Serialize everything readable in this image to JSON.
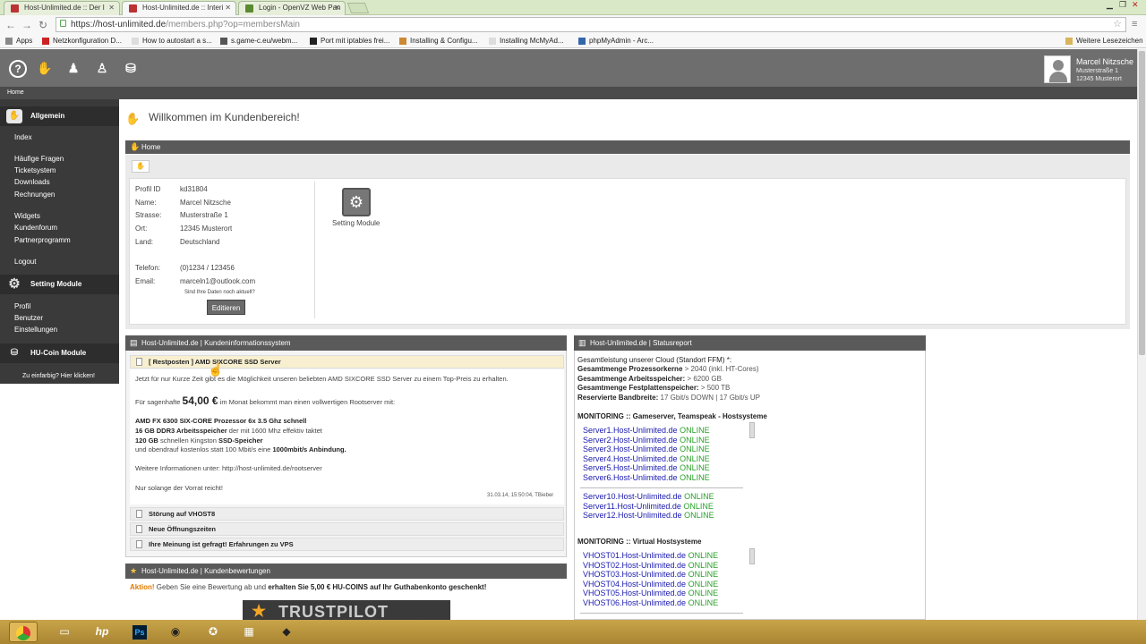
{
  "browser": {
    "tabs": [
      {
        "label": "Host-Unlimited.de :: Der I"
      },
      {
        "label": "Host-Unlimited.de :: Interi"
      },
      {
        "label": "Login - OpenVZ Web Pan"
      }
    ],
    "url_host": "https://host-unlimited.de",
    "url_path": "/members.php?op=membersMain",
    "bookmarks": [
      "Apps",
      "Netzkonfiguration D...",
      "How to autostart a s...",
      "s.game-c.eu/webm...",
      "Port mit iptables frei...",
      "Installing & Configu...",
      "Installing McMyAd...",
      "phpMyAdmin - Arc..."
    ],
    "other_bookmarks": "Weitere Lesezeichen"
  },
  "header": {
    "icons": [
      "help-icon",
      "handshake-icon",
      "user-icon",
      "account-icon",
      "coins-icon"
    ],
    "user_name": "Marcel Nitzsche",
    "user_street": "Musterstraße 1",
    "user_city": "12345 Musterort"
  },
  "breadcrumb": "Home",
  "sidebar": {
    "sec1": "Allgemein",
    "items1": [
      "Index",
      "Häufige Fragen",
      "Ticketsystem",
      "Downloads",
      "Rechnungen",
      "Widgets",
      "Kundenforum",
      "Partnerprogramm",
      "Logout"
    ],
    "sec2": "Setting Module",
    "items2": [
      "Profil",
      "Benutzer",
      "Einstellungen"
    ],
    "sec3": "HU-Coin Module",
    "coin_hint": "Zu einfarbig? Hier klicken!"
  },
  "main": {
    "welcome": "Willkommen im Kundenbereich!",
    "home_title": "Home",
    "profile": {
      "labels": [
        "Profil ID",
        "Name:",
        "Strasse:",
        "Ort:",
        "Land:",
        "Telefon:",
        "Email:"
      ],
      "values": [
        "kd31804",
        "Marcel Nitzsche",
        "Musterstraße 1",
        "12345 Musterort",
        "Deutschland",
        "(0)1234 / 123456",
        "marceln1@outlook.com"
      ],
      "hint": "Sind Ihre Daten noch aktuell?",
      "edit": "Editieren"
    },
    "module_label": "Setting Module"
  },
  "info": {
    "title": "Host-Unlimited.de | Kundeninformationssystem",
    "items": [
      "[ Restposten ] AMD SIXCORE SSD Server",
      "Störung auf VHOST8",
      "Neue Öffnungszeiten",
      "Ihre Meinung ist gefragt! Erfahrungen zu VPS"
    ],
    "line1": "Jetzt für nur Kurze Zeit gibt es die Möglichkeit unseren beliebten AMD SIXCORE SSD Server zu einem Top-Preis zu erhalten.",
    "price_pre": "Für sagenhafte",
    "price": "54,00 €",
    "price_post": "im Monat bekommt man einen vollwertigen Rootserver mit:",
    "spec1": "AMD FX 6300 SIX-CORE Prozessor 6x 3.5 Ghz schnell",
    "spec2a": "16 GB DDR3 Arbeitsspeicher",
    "spec2b": " der mit 1600 Mhz effektiv taktet",
    "spec3a": "120 GB",
    "spec3b": " schnellen Kingston ",
    "spec3c": "SSD-Speicher",
    "spec4a": "und obendrauf kostenlos statt 100 Mbit/s eine ",
    "spec4b": "1000mbit/s Anbindung.",
    "more": "Weitere Informationen unter: http://host-unlimited.de/rootserver",
    "stock": "Nur solange der Vorrat reicht!",
    "timestamp": "31.03.14, 15:50:04, TBieber"
  },
  "status": {
    "title": "Host-Unlimited.de | Statusreport",
    "intro": "Gesamtleistung unserer Cloud (Standort FFM) *:",
    "rows": [
      {
        "k": "Gesamtmenge Prozessorkerne",
        "v": " > 2040 (inkl. HT-Cores)"
      },
      {
        "k": "Gesamtmenge Arbeitsspeicher:",
        "v": " > 6200 GB"
      },
      {
        "k": "Gesamtmenge Festplattenspeicher:",
        "v": " > 500 TB"
      },
      {
        "k": "Reservierte Bandbreite:",
        "v": " 17 Gbit/s DOWN | 17 Gbit/s UP"
      }
    ],
    "mon1": "MONITORING :: Gameserver, Teamspeak - Hostsysteme",
    "servers1": [
      "Server1.Host-Unlimited.de",
      "Server2.Host-Unlimited.de",
      "Server3.Host-Unlimited.de",
      "Server4.Host-Unlimited.de",
      "Server5.Host-Unlimited.de",
      "Server6.Host-Unlimited.de"
    ],
    "servers2": [
      "Server10.Host-Unlimited.de",
      "Server11.Host-Unlimited.de",
      "Server12.Host-Unlimited.de"
    ],
    "mon2": "MONITORING :: Virtual Hostsysteme",
    "vhosts": [
      "VHOST01.Host-Unlimited.de",
      "VHOST02.Host-Unlimited.de",
      "VHOST03.Host-Unlimited.de",
      "VHOST04.Host-Unlimited.de",
      "VHOST05.Host-Unlimited.de",
      "VHOST06.Host-Unlimited.de"
    ],
    "online": "ONLINE"
  },
  "reviews": {
    "title": "Host-Unlimited.de | Kundenbewertungen",
    "action": "Aktion!",
    "text1": " Geben Sie eine Bewertung ab und ",
    "text2": "erhalten Sie 5,00 € HU-COINS auf Ihr Guthabenkonto geschenkt!",
    "logo": "TRUSTPILOT"
  },
  "colors": {
    "header": "#6e6e6e",
    "sidebar": "#3a3a3a",
    "online": "#2aa02a",
    "link": "#1a1ab0"
  }
}
